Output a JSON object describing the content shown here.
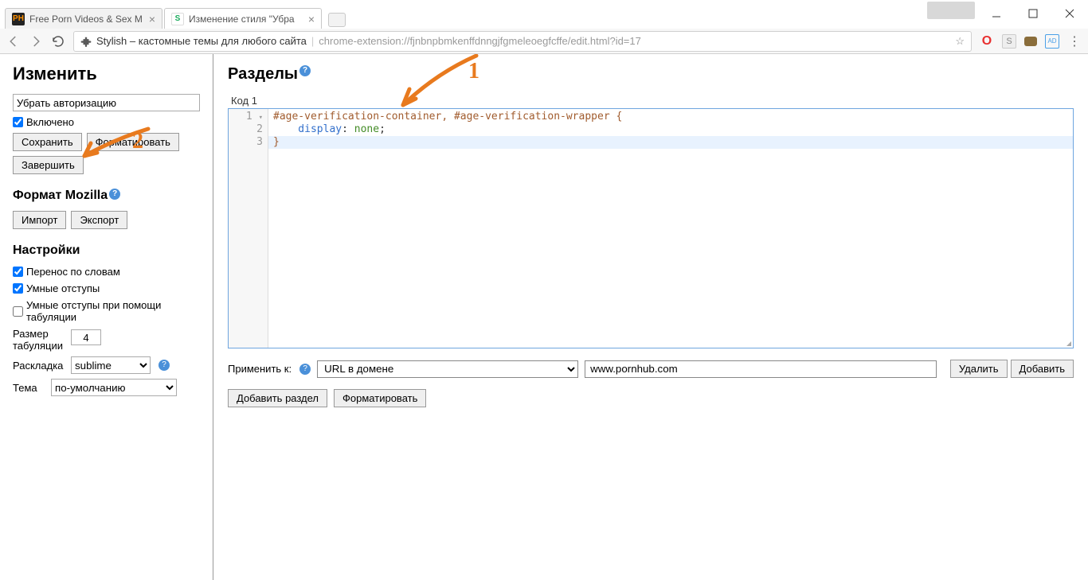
{
  "tabs": [
    {
      "title": "Free Porn Videos & Sex M",
      "favicon_text": "PH",
      "favicon_bg": "#222",
      "favicon_fg": "#ff9000"
    },
    {
      "title": "Изменение стиля \"Убра",
      "favicon_text": "S",
      "favicon_bg": "#fff",
      "favicon_fg": "#1aab5c",
      "active": true
    }
  ],
  "omnibox": {
    "title": "Stylish – кастомные темы для любого сайта",
    "url": "chrome-extension://fjnbnpbmkenffdnngjfgmeleoegfcffe/edit.html?id=17"
  },
  "sidebar": {
    "h_edit": "Изменить",
    "name_value": "Убрать авторизацию",
    "enabled_label": "Включено",
    "btn_save": "Сохранить",
    "btn_format": "Форматировать",
    "btn_finish": "Завершить",
    "h_mozilla": "Формат Mozilla",
    "btn_import": "Импорт",
    "btn_export": "Экспорт",
    "h_settings": "Настройки",
    "cb_wrap": "Перенос по словам",
    "cb_smart": "Умные отступы",
    "cb_smart_tab": "Умные отступы при помощи табуляции",
    "lbl_tabsize": "Размер табуляции",
    "val_tabsize": "4",
    "lbl_keymap": "Раскладка",
    "val_keymap": "sublime",
    "lbl_theme": "Тема",
    "val_theme": "по-умолчанию"
  },
  "main": {
    "h_sections": "Разделы",
    "section_label": "Код 1",
    "code": {
      "l1_sel": "#age-verification-container, #age-verification-wrapper",
      "l1_brace": " {",
      "l2_prop": "    display",
      "l2_colon": ": ",
      "l2_val": "none",
      "l2_semi": ";",
      "l3": "}"
    },
    "applies_label": "Применить к:",
    "applies_type": "URL в домене",
    "applies_value": "www.pornhub.com",
    "btn_delete": "Удалить",
    "btn_add": "Добавить",
    "btn_add_section": "Добавить раздел",
    "btn_format2": "Форматировать"
  },
  "annotations": {
    "a1": "1",
    "a2": "2"
  }
}
